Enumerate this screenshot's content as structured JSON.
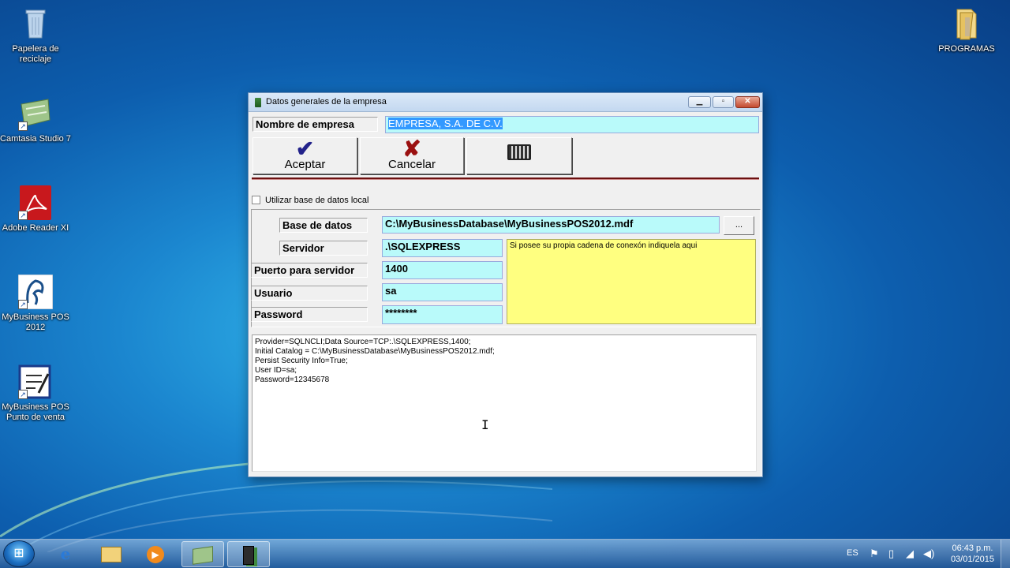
{
  "desktop": {
    "icons_left": [
      {
        "name": "recycle-bin-icon",
        "label": "Papelera de reciclaje"
      },
      {
        "name": "camtasia-icon",
        "label": "Camtasia Studio 7"
      },
      {
        "name": "adobe-reader-icon",
        "label": "Adobe Reader XI"
      },
      {
        "name": "mybusiness-pos-icon",
        "label": "MyBusiness POS 2012"
      },
      {
        "name": "punto-de-venta-icon",
        "label": "MyBusiness POS Punto de venta"
      }
    ],
    "icon_right": {
      "name": "folder-icon",
      "label": "PROGRAMAS"
    }
  },
  "window": {
    "title": "Datos generales de la empresa",
    "buttons": {
      "minimize": "▁",
      "maximize": "▫",
      "close": "✕"
    },
    "company_label": "Nombre de empresa",
    "company_value": "EMPRESA, S.A. DE C.V.",
    "toolbar": {
      "accept": "Aceptar",
      "cancel": "Cancelar",
      "keyboard_icon": "keyboard-icon"
    },
    "local_db_checkbox": "Utilizar base de datos local",
    "fields": {
      "database_label": "Base de datos",
      "database_value": "C:\\MyBusinessDatabase\\MyBusinessPOS2012.mdf",
      "browse": "...",
      "server_label": "Servidor",
      "server_value": ".\\SQLEXPRESS",
      "port_label": "Puerto para servidor",
      "port_value": "1400",
      "user_label": "Usuario",
      "user_value": "sa",
      "password_label": "Password",
      "password_value": "********"
    },
    "note": "Si posee su propia cadena de conexón indiquela aqui",
    "connection_string": [
      "Provider=SQLNCLI;Data Source=TCP:.\\SQLEXPRESS,1400;",
      "Initial Catalog = C:\\MyBusinessDatabase\\MyBusinessPOS2012.mdf;",
      "Persist Security Info=True;",
      "User ID=sa;",
      "Password=12345678"
    ]
  },
  "taskbar": {
    "language": "ES",
    "time": "06:43 p.m.",
    "date": "03/01/2015"
  }
}
